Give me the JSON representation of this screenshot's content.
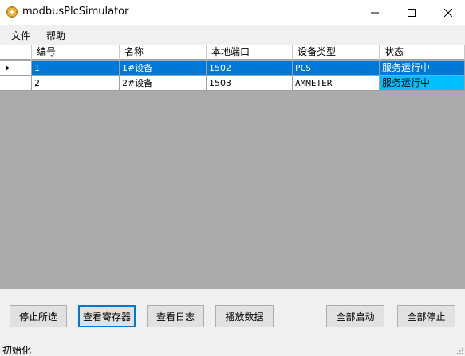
{
  "window": {
    "title": "modbusPlcSimulator"
  },
  "menu": {
    "file": "文件",
    "help": "帮助"
  },
  "grid": {
    "columns": [
      "编号",
      "名称",
      "本地端口",
      "设备类型",
      "状态"
    ],
    "rows": [
      {
        "id": "1",
        "name": "1#设备",
        "port": "1502",
        "type": "PCS",
        "status": "服务运行中"
      },
      {
        "id": "2",
        "name": "2#设备",
        "port": "1503",
        "type": "AMMETER",
        "status": "服务运行中"
      }
    ]
  },
  "buttons": {
    "stop_selected": "停止所选",
    "view_registers": "查看寄存器",
    "view_log": "查看日志",
    "playback": "播放数据",
    "start_all": "全部启动",
    "stop_all": "全部停止"
  },
  "status_bar": {
    "text": "初始化"
  },
  "colors": {
    "selection": "#0078d7",
    "running": "#00bfff",
    "grid_bg": "#ababab"
  },
  "icons": {
    "app": "gear-icon",
    "row_pointer": "triangle-right-icon"
  }
}
